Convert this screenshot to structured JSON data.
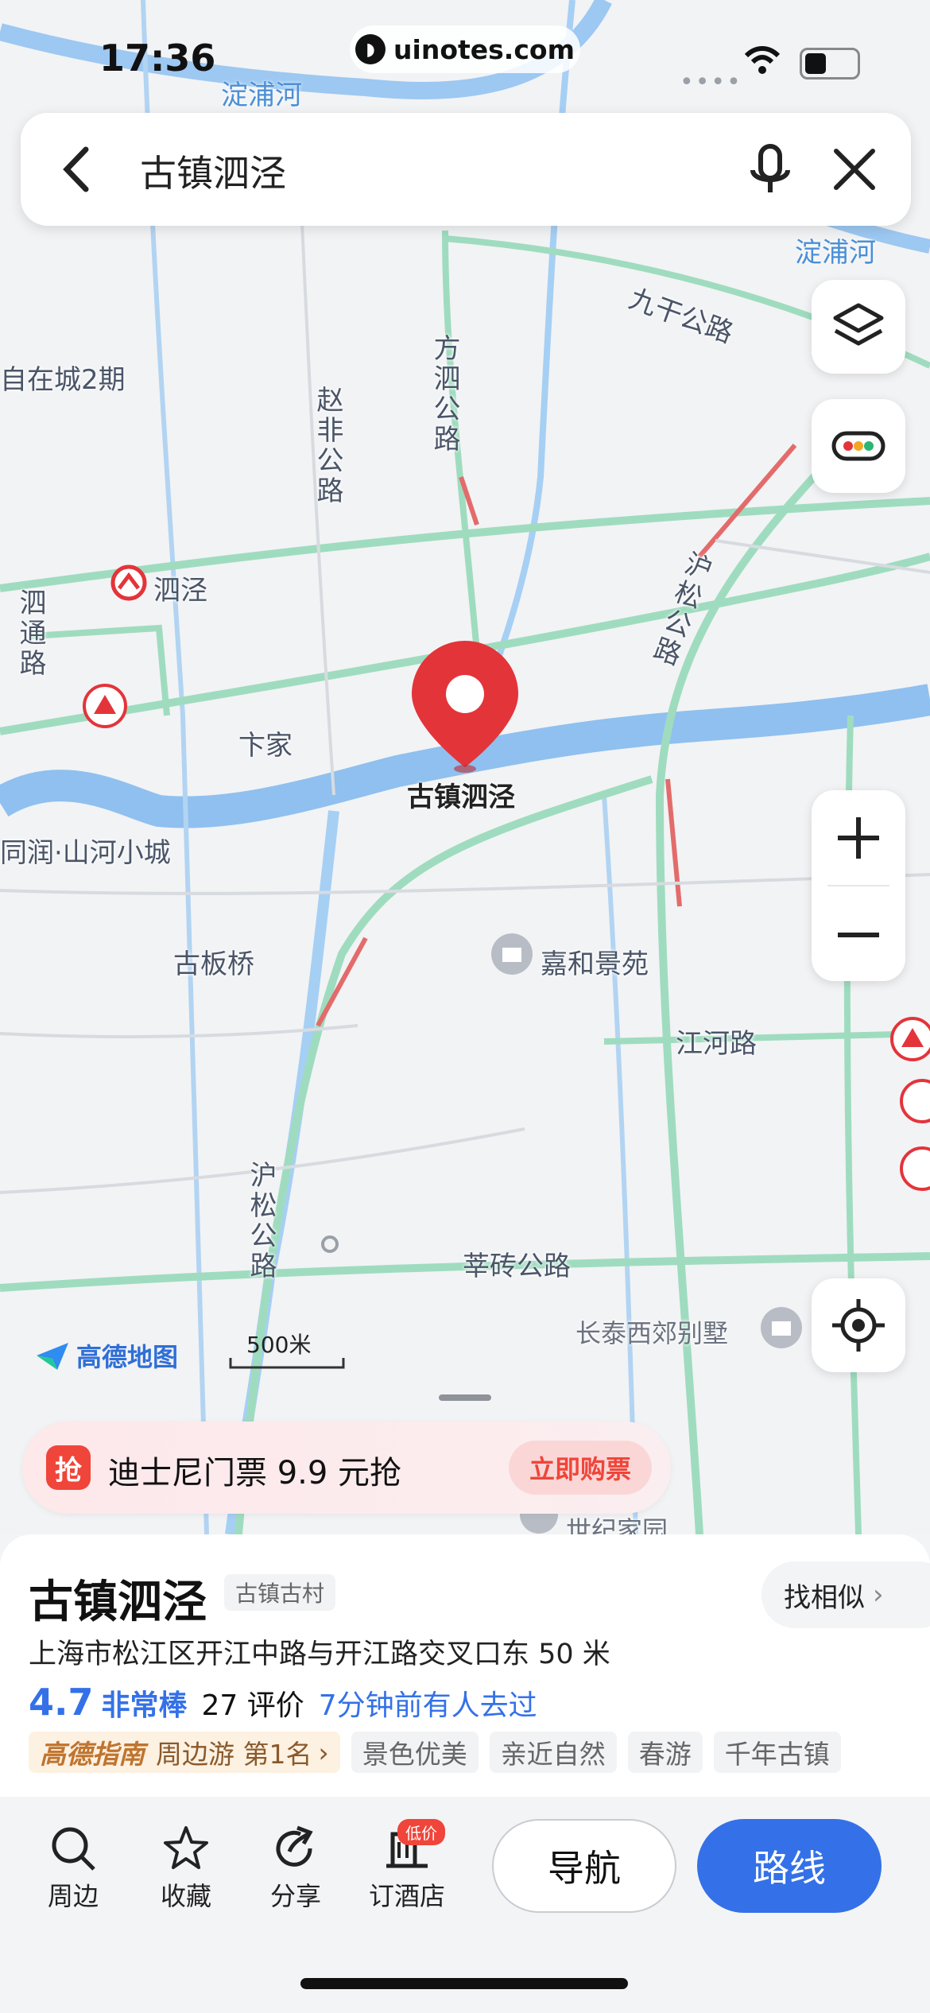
{
  "status": {
    "time": "17:36",
    "url": "uinotes.com"
  },
  "search": {
    "query": "古镇泗泾"
  },
  "map": {
    "labels": {
      "rivers": [
        "淀浦河",
        "淀浦河"
      ],
      "roads": [
        "九干公路",
        "方泗公路",
        "赵非公路",
        "沪松公路",
        "泗通路",
        "沪松公路",
        "江河路",
        "莘砖公路"
      ],
      "places": [
        "自在城2期",
        "泗泾",
        "卞家",
        "同润·山河小城",
        "古板桥",
        "嘉和景苑",
        "长泰西郊别墅",
        "世纪家园"
      ],
      "pin": "古镇泗泾",
      "logo": "高德地图",
      "scale": "500米"
    }
  },
  "promo": {
    "icon": "抢",
    "text": "迪士尼门票 9.9 元抢",
    "button": "立即购票"
  },
  "place": {
    "name": "古镇泗泾",
    "category": "古镇古村",
    "similar": "找相似",
    "address": "上海市松江区开江中路与开江路交叉口东 50 米",
    "score": "4.7",
    "score_text": "非常棒",
    "reviews": "27 评价",
    "visited": "7分钟前有人去过",
    "guide_brand": "高德指南",
    "guide_rank": "周边游 第1名",
    "tags": [
      "景色优美",
      "亲近自然",
      "春游",
      "千年古镇"
    ]
  },
  "actions": {
    "nearby": "周边",
    "favorite": "收藏",
    "share": "分享",
    "hotel": "订酒店",
    "hotel_badge": "低价",
    "navigate": "导航",
    "route": "路线"
  }
}
